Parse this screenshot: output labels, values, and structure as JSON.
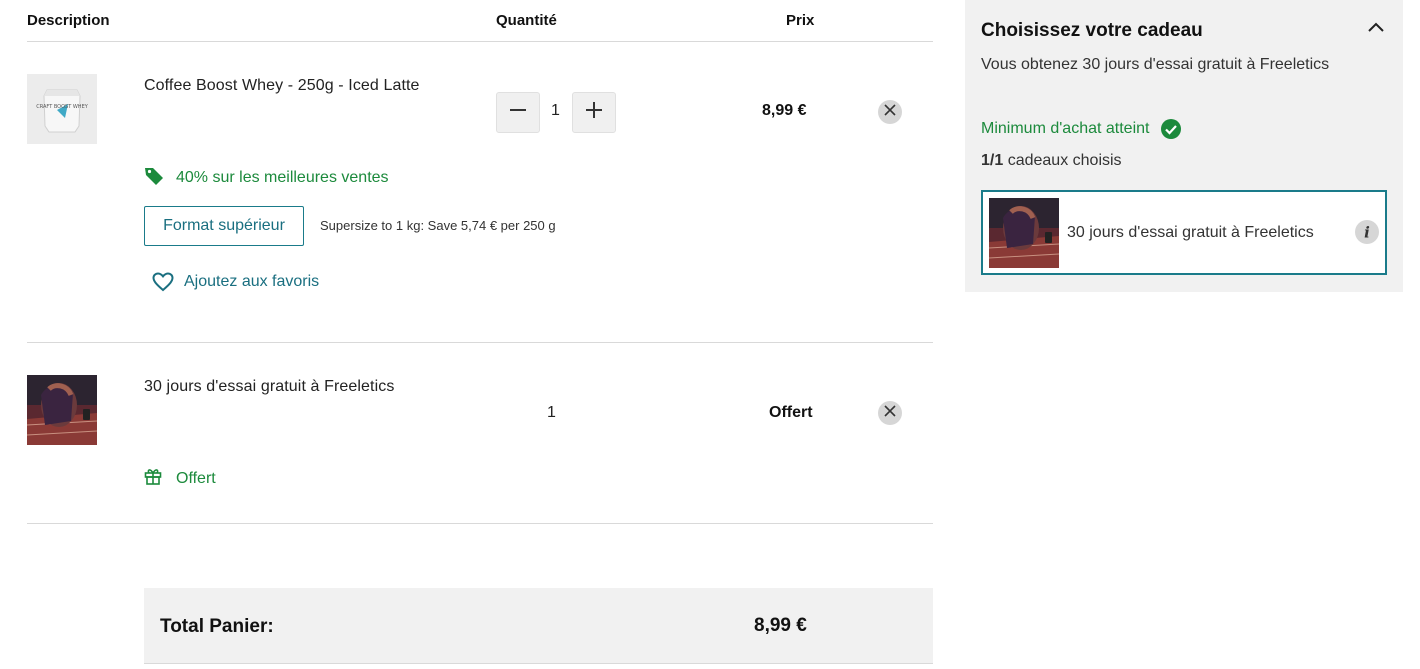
{
  "table_header": {
    "description": "Description",
    "quantity": "Quantité",
    "price": "Prix"
  },
  "items": [
    {
      "title": "Coffee Boost Whey - 250g - Iced Latte",
      "quantity": "1",
      "price": "8,99 €",
      "promo": "40% sur les meilleures ventes",
      "format_button": "Format supérieur",
      "supersize_note": "Supersize to 1 kg: Save 5,74 € per 250 g",
      "favorite": "Ajoutez aux favoris",
      "pouch_label": "CRAFT BOOST WHEY"
    },
    {
      "title": "30 jours d'essai gratuit à Freeletics",
      "quantity": "1",
      "price": "Offert",
      "gift_label": "Offert"
    }
  ],
  "total": {
    "label": "Total Panier:",
    "value": "8,99 €"
  },
  "gift_panel": {
    "title": "Choisissez votre cadeau",
    "subtitle": "Vous obtenez 30 jours d'essai gratuit à Freeletics",
    "minimum_reached": "Minimum d'achat atteint",
    "chosen_count": "1/1",
    "chosen_text": "cadeaux choisis",
    "gift_name": "30 jours d'essai gratuit à Freeletics"
  },
  "colors": {
    "accent_teal": "#1a7b8a",
    "success_green": "#1c8a3c",
    "panel_bg": "#f1f1f1"
  },
  "icons": [
    "minus-icon",
    "plus-icon",
    "close-icon",
    "tag-icon",
    "heart-icon",
    "gift-icon",
    "check-circle-icon",
    "chevron-up-icon",
    "info-icon"
  ]
}
